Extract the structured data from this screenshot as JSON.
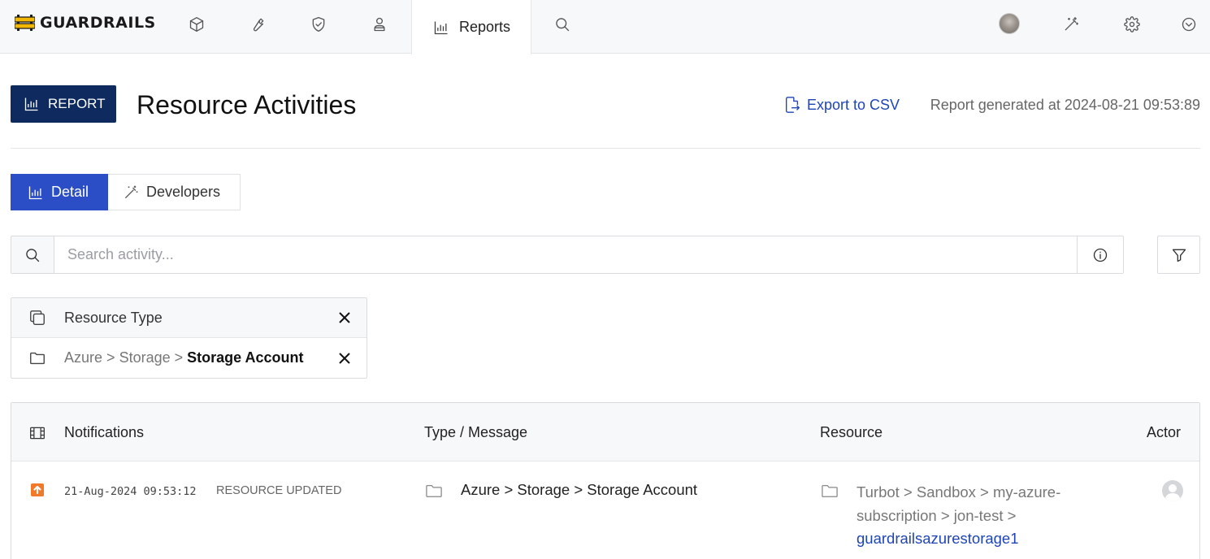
{
  "app": {
    "brand": "GUARDRAILS"
  },
  "nav": {
    "active_tab": "Reports",
    "icons": [
      "cube-icon",
      "wrench-icon",
      "shield-check-icon",
      "user-tie-icon",
      "search-icon",
      "avatar",
      "magic-wand-icon",
      "gear-icon",
      "chevron-down-circle-icon"
    ]
  },
  "header": {
    "badge": "REPORT",
    "title": "Resource Activities",
    "export_label": "Export to CSV",
    "generated": "Report generated at 2024-08-21 09:53:89"
  },
  "tabs": [
    {
      "label": "Detail",
      "active": true
    },
    {
      "label": "Developers",
      "active": false
    }
  ],
  "search": {
    "placeholder": "Search activity..."
  },
  "filters": {
    "heading": "Resource Type",
    "path": [
      "Azure",
      "Storage"
    ],
    "path_sep": ">",
    "leaf": "Storage Account"
  },
  "table": {
    "columns": [
      "Notifications",
      "Type / Message",
      "Resource",
      "Actor"
    ],
    "rows": [
      {
        "timestamp": "21-Aug-2024 09:53:12",
        "event": "RESOURCE UPDATED",
        "type": "Azure > Storage > Storage Account",
        "resource_path_1": "Turbot > Sandbox > my-azure-",
        "resource_path_2": "subscription > jon-test >",
        "resource_link": "guardrailsazurestorage1"
      }
    ]
  },
  "colors": {
    "accent": "#2b4ec7",
    "badge": "#0e2a5e",
    "link": "#1f45b5",
    "update": "#f0792a"
  }
}
